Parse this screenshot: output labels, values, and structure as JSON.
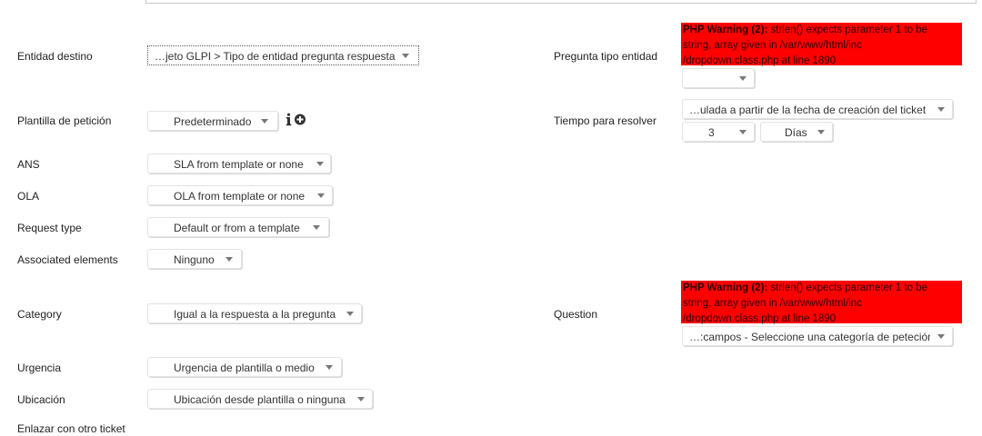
{
  "form": {
    "entidad_destino": {
      "label": "Entidad destino",
      "value": "…jeto GLPI > Tipo de entidad pregunta respuesta"
    },
    "plantilla": {
      "label": "Plantilla de petición",
      "value": "Predeterminado"
    },
    "ans": {
      "label": "ANS",
      "value": "SLA from template or none"
    },
    "ola": {
      "label": "OLA",
      "value": "OLA from template or none"
    },
    "request_type": {
      "label": "Request type",
      "value": "Default or from a template"
    },
    "associated": {
      "label": "Associated elements",
      "value": "Ninguno"
    },
    "category": {
      "label": "Category",
      "value": "Igual a la respuesta a la pregunta"
    },
    "urgencia": {
      "label": "Urgencia",
      "value": "Urgencia de plantilla o medio"
    },
    "ubicacion": {
      "label": "Ubicación",
      "value": "Ubicación desde plantilla o ninguna"
    },
    "enlazar": {
      "label": "Enlazar con otro ticket"
    },
    "pregunta_tipo_entidad": {
      "label": "Pregunta tipo entidad",
      "value": ""
    },
    "tiempo_resolver": {
      "label": "Tiempo para resolver",
      "value": "…ulada a partir de la fecha de creación del ticket",
      "amount": "3",
      "unit": "Días"
    },
    "question": {
      "label": "Question",
      "value": "…:campos - Seleccione una categoría de peteción"
    }
  },
  "warnings": {
    "title": "PHP Warning (2):",
    "line1": " strlen() expects parameter 1 to be",
    "line2": "string, array given in /var/www/html/inc",
    "line3": "/dropdown.class.php at line 1890"
  },
  "colors": {
    "warning_bg": "#ff0000"
  }
}
